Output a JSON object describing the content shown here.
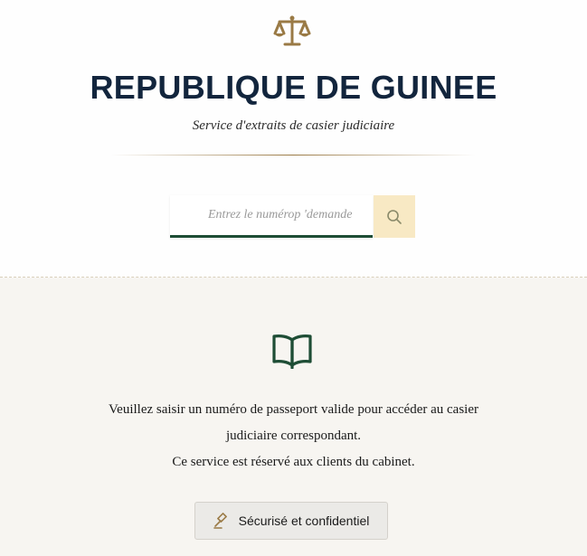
{
  "header": {
    "logo_icon": "scales-of-justice-icon",
    "title": "REPUBLIQUE DE GUINEE",
    "subtitle": "Service d'extraits de casier judiciaire"
  },
  "search": {
    "placeholder": "Entrez le numérop 'demande",
    "value": "",
    "button_icon": "search-icon"
  },
  "info": {
    "icon": "open-book-icon",
    "line1": "Veuillez saisir un numéro de passeport valide pour accéder au casier",
    "line2": "judiciaire correspondant.",
    "line3": "Ce service est réservé aux clients du cabinet."
  },
  "badge": {
    "icon": "gavel-icon",
    "label": "Sécurisé et confidentiel"
  },
  "colors": {
    "title": "#12253d",
    "gold": "#9a7a45",
    "green": "#1e4d35",
    "search_button_bg": "#f8e9c4",
    "lower_bg": "#f7f5f1"
  }
}
